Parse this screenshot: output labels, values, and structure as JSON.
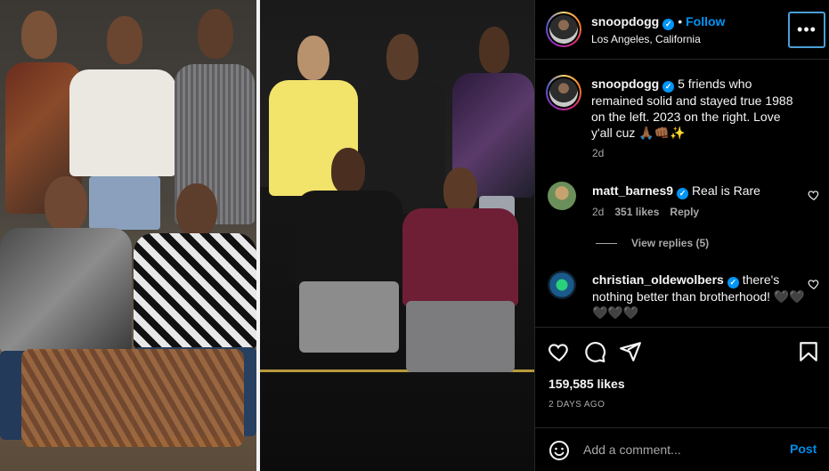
{
  "post": {
    "username": "snoopdogg",
    "follow_label": "Follow",
    "location": "Los Angeles, California",
    "caption": "5 friends who remained solid and stayed true 1988 on the left. 2023 on the right. Love y'all cuz 🙏🏾👊🏾✨",
    "caption_age": "2d",
    "likes": "159,585 likes",
    "date": "2 DAYS AGO"
  },
  "comments": [
    {
      "username": "matt_barnes9",
      "text": "Real is Rare",
      "age": "2d",
      "likes": "351 likes",
      "reply_label": "Reply",
      "view_replies": "View replies (5)"
    },
    {
      "username": "christian_oldewolbers",
      "text": "there's nothing better than brotherhood! 🖤🖤🖤🖤🖤"
    }
  ],
  "add_comment": {
    "placeholder": "Add a comment...",
    "post_label": "Post"
  },
  "colors": {
    "accent": "#0095f6",
    "background": "#000000",
    "secondary_text": "#a8a8a8"
  },
  "icons": [
    "verified-badge-icon",
    "more-options-icon",
    "heart-icon",
    "comment-icon",
    "share-icon",
    "bookmark-icon",
    "emoji-icon"
  ]
}
